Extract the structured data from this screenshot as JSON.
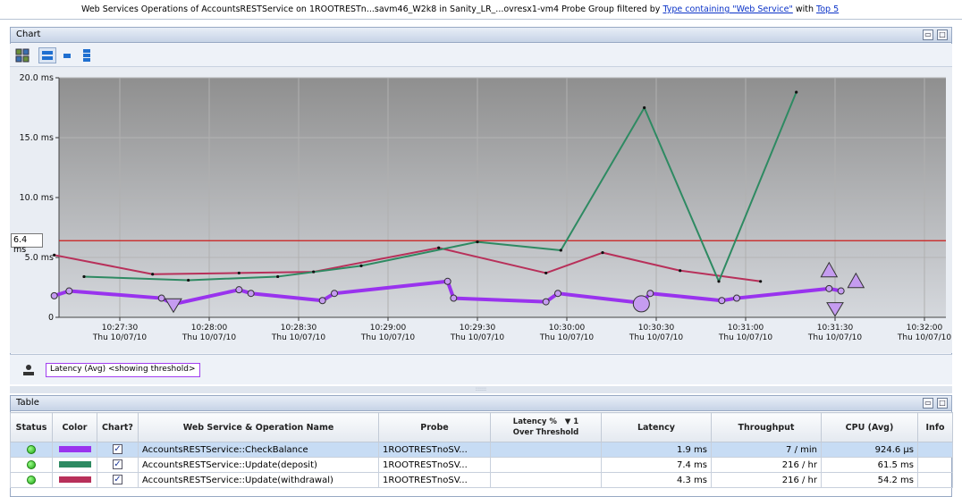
{
  "title": {
    "text": "Web Services Operations of AccountsRESTService on 1ROOTRESTn...savm46_W2k8 in Sanity_LR_...ovresx1-vm4 Probe Group filtered by ",
    "link1": "Type containing \"Web Service\"",
    "mid": " with ",
    "link2": "Top 5"
  },
  "chart_panel": {
    "title": "Chart",
    "legend_label": "Latency (Avg) <showing threshold>"
  },
  "table_panel": {
    "title": "Table"
  },
  "splitter_grip": "::::::",
  "threshold_label": "6.4 ms",
  "colors": {
    "check_balance": "#9933ee",
    "deposit": "#2e8a62",
    "withdrawal": "#b8305a",
    "threshold": "#cc1a1a"
  },
  "chart_data": {
    "type": "line",
    "ylim": [
      0,
      20
    ],
    "y_ticks": [
      "0",
      "5.0 ms",
      "10.0 ms",
      "15.0 ms",
      "20.0 ms"
    ],
    "x_ticks": [
      {
        "time": "10:27:30",
        "date": "Thu 10/07/10"
      },
      {
        "time": "10:28:00",
        "date": "Thu 10/07/10"
      },
      {
        "time": "10:28:30",
        "date": "Thu 10/07/10"
      },
      {
        "time": "10:29:00",
        "date": "Thu 10/07/10"
      },
      {
        "time": "10:29:30",
        "date": "Thu 10/07/10"
      },
      {
        "time": "10:30:00",
        "date": "Thu 10/07/10"
      },
      {
        "time": "10:30:30",
        "date": "Thu 10/07/10"
      },
      {
        "time": "10:31:00",
        "date": "Thu 10/07/10"
      },
      {
        "time": "10:31:30",
        "date": "Thu 10/07/10"
      },
      {
        "time": "10:32:00",
        "date": "Thu 10/07/10"
      }
    ],
    "threshold": 6.4,
    "series": [
      {
        "name": "AccountsRESTService::CheckBalance",
        "color": "#9933ee",
        "x": [
          "10:27:08",
          "10:27:13",
          "10:27:44",
          "10:27:48",
          "10:28:10",
          "10:28:14",
          "10:28:38",
          "10:28:42",
          "10:29:20",
          "10:29:22",
          "10:29:53",
          "10:29:57",
          "10:30:25",
          "10:30:28",
          "10:30:52",
          "10:30:57",
          "10:31:28",
          "10:31:32"
        ],
        "y": [
          1.8,
          2.2,
          1.6,
          1.1,
          2.3,
          2.0,
          1.4,
          2.0,
          3.0,
          1.6,
          1.3,
          2.0,
          1.2,
          2.0,
          1.4,
          1.6,
          2.4,
          2.2
        ]
      },
      {
        "name": "AccountsRESTService::Update(deposit)",
        "color": "#2e8a62",
        "x": [
          "10:27:18",
          "10:27:53",
          "10:28:23",
          "10:28:51",
          "10:29:30",
          "10:29:58",
          "10:30:26",
          "10:30:51",
          "10:31:17"
        ],
        "y": [
          3.4,
          3.1,
          3.4,
          4.3,
          6.3,
          5.6,
          17.5,
          3.0,
          18.8
        ]
      },
      {
        "name": "AccountsRESTService::Update(withdrawal)",
        "color": "#b8305a",
        "x": [
          "10:27:08",
          "10:27:41",
          "10:28:10",
          "10:28:35",
          "10:29:17",
          "10:29:53",
          "10:30:12",
          "10:30:38",
          "10:31:05"
        ],
        "y": [
          5.2,
          3.6,
          3.7,
          3.8,
          5.8,
          3.7,
          5.4,
          3.9,
          3.0
        ]
      }
    ]
  },
  "table": {
    "columns": [
      "Status",
      "Color",
      "Chart?",
      "Web Service & Operation Name",
      "Probe",
      "Latency %",
      "1",
      "Over Threshold",
      "Latency",
      "Throughput",
      "CPU (Avg)",
      "Info"
    ],
    "rows": [
      {
        "name": "AccountsRESTService::CheckBalance",
        "probe": "1ROOTRESTnoSV...",
        "over": "",
        "latency": "1.9 ms",
        "throughput": "7 / min",
        "cpu": "924.6 µs",
        "info": "",
        "color": "#9933ee",
        "check": "✓"
      },
      {
        "name": "AccountsRESTService::Update(deposit)",
        "probe": "1ROOTRESTnoSV...",
        "over": "",
        "latency": "7.4 ms",
        "throughput": "216 / hr",
        "cpu": "61.5 ms",
        "info": "",
        "color": "#2e8a62",
        "check": "✓"
      },
      {
        "name": "AccountsRESTService::Update(withdrawal)",
        "probe": "1ROOTRESTnoSV...",
        "over": "",
        "latency": "4.3 ms",
        "throughput": "216 / hr",
        "cpu": "54.2 ms",
        "info": "",
        "color": "#b8305a",
        "check": "✓"
      }
    ]
  }
}
